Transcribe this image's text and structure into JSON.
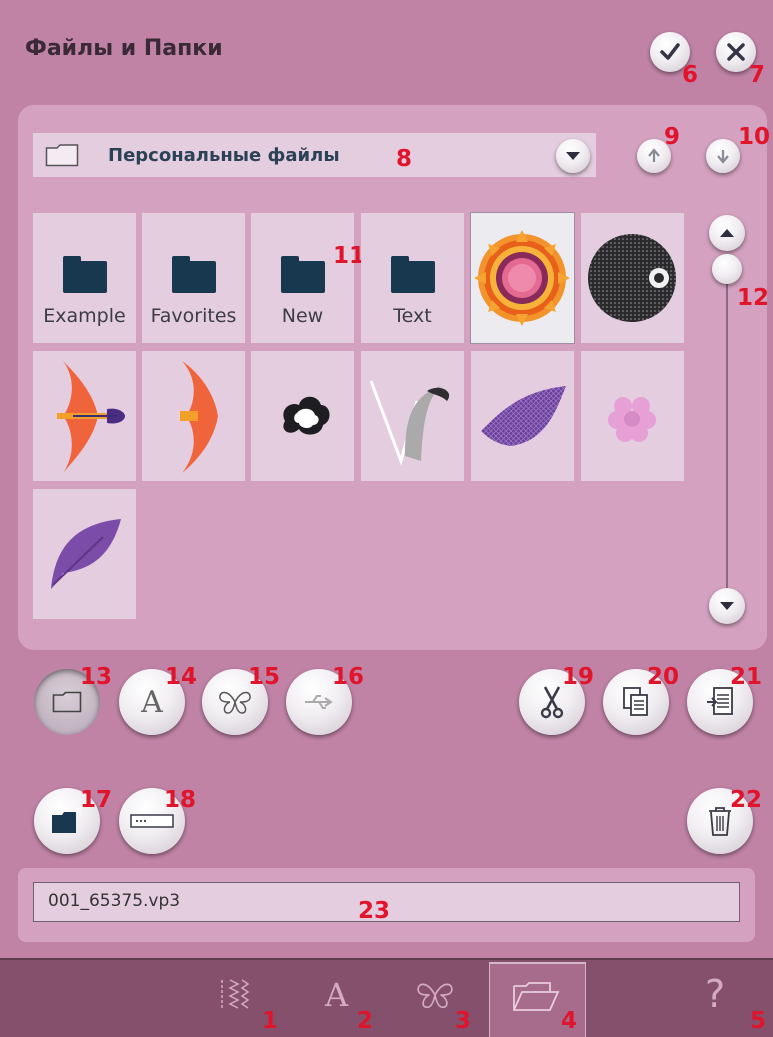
{
  "title": "Файлы и Папки",
  "path": "Персональные файлы",
  "folders": [
    {
      "label": "Example"
    },
    {
      "label": "Favorites"
    },
    {
      "label": "New"
    },
    {
      "label": "Text"
    }
  ],
  "filename": "001_65375.vp3",
  "icons": {
    "confirm": "check-icon",
    "cancel": "close-icon",
    "scroll_up": "arrow-up-icon",
    "scroll_down": "arrow-down-icon",
    "cut": "scissors-icon",
    "copy": "copy-icon",
    "paste": "paste-icon",
    "delete": "trash-icon",
    "help": "question-icon"
  },
  "callouts": {
    "c1": "1",
    "c2": "2",
    "c3": "3",
    "c4": "4",
    "c5": "5",
    "c6": "6",
    "c7": "7",
    "c8": "8",
    "c9": "9",
    "c10": "10",
    "c11": "11",
    "c12": "12",
    "c13": "13",
    "c14": "14",
    "c15": "15",
    "c16": "16",
    "c17": "17",
    "c18": "18",
    "c19": "19",
    "c20": "20",
    "c21": "21",
    "c22": "22",
    "c23": "23"
  },
  "colors": {
    "background": "#c083a6",
    "panel": "#d4a2c0",
    "tile": "#e5cde0",
    "callout": "#e0142b",
    "bottom_bar": "#84506c"
  }
}
